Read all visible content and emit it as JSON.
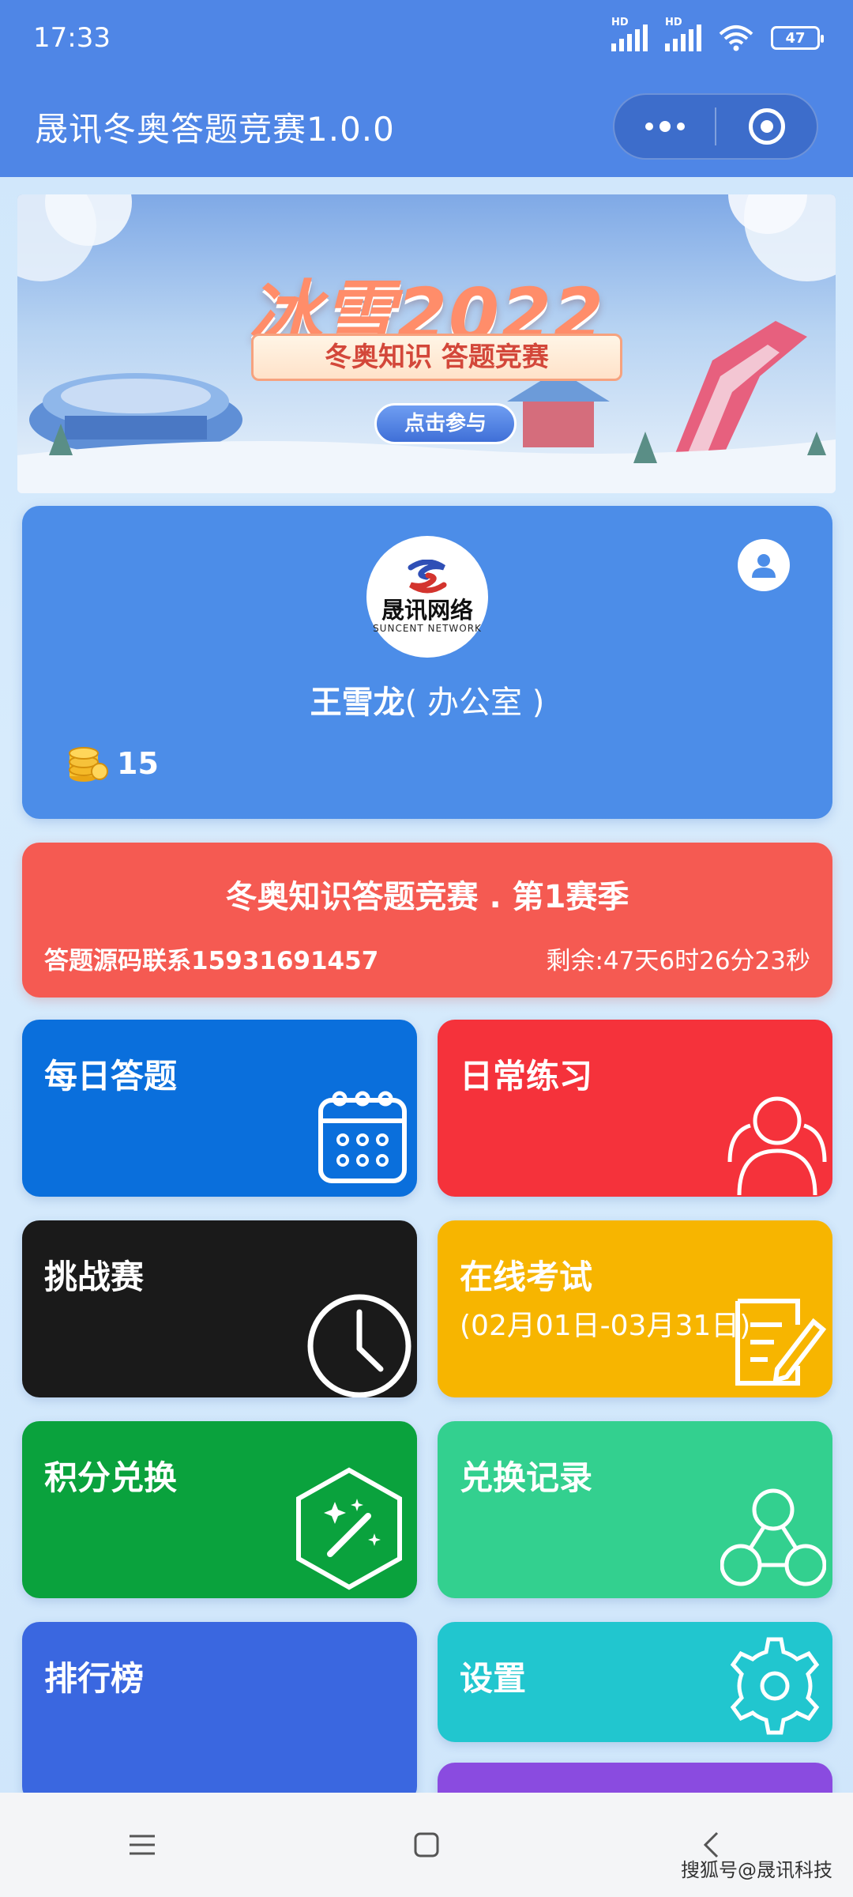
{
  "status_bar": {
    "time": "17:33",
    "signal_label": "HD",
    "battery": "47"
  },
  "title_bar": {
    "title": "晟讯冬奥答题竞赛1.0.0",
    "menu_icon": "more-dots-icon",
    "close_icon": "target-icon"
  },
  "banner": {
    "headline": "冰雪2022",
    "ribbon": "冬奥知识 答题竞赛",
    "button": "点击参与"
  },
  "profile": {
    "logo_cn": "晟讯网络",
    "logo_en": "SUNCENT NETWORK",
    "name": "王雪龙",
    "department": "( 办公室 )",
    "coins": "15"
  },
  "season": {
    "title": "冬奥知识答题竞赛 . 第1赛季",
    "contact": "答题源码联系15931691457",
    "remaining": "剩余:47天6时26分23秒"
  },
  "tiles": [
    {
      "label": "每日答题",
      "sub": "",
      "color": "#0a6fdc",
      "icon": "calendar-icon"
    },
    {
      "label": "日常练习",
      "sub": "",
      "color": "#f5323b",
      "icon": "users-icon"
    },
    {
      "label": "挑战赛",
      "sub": "",
      "color": "#1a1a1a",
      "icon": "clock-icon"
    },
    {
      "label": "在线考试",
      "sub": "(02月01日-03月31日)",
      "color": "#f7b500",
      "icon": "edit-document-icon"
    },
    {
      "label": "积分兑换",
      "sub": "",
      "color": "#0aa23d",
      "icon": "magic-wand-icon"
    },
    {
      "label": "兑换记录",
      "sub": "",
      "color": "#33d08f",
      "icon": "network-icon"
    },
    {
      "label": "排行榜",
      "sub": "",
      "color": "#3a67e0",
      "icon": ""
    },
    {
      "label": "设置",
      "sub": "",
      "color": "#21c6cf",
      "icon": "gear-icon"
    }
  ],
  "nav": {
    "menu": "menu-icon",
    "home": "home-square-icon",
    "back": "back-chevron-icon"
  },
  "watermark": "搜狐号@晟讯科技"
}
